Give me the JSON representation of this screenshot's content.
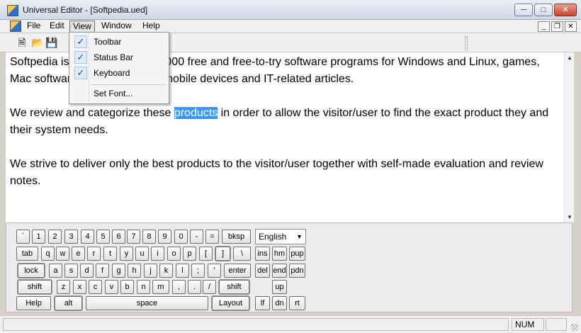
{
  "window": {
    "title": "Universal Editor - [Softpedia.ued]"
  },
  "menubar": {
    "items": [
      "File",
      "Edit",
      "View",
      "Window",
      "Help"
    ],
    "active": "View"
  },
  "view_menu": {
    "items": [
      {
        "label": "Toolbar",
        "checked": true
      },
      {
        "label": "Status Bar",
        "checked": true
      },
      {
        "label": "Keyboard",
        "checked": true
      },
      {
        "label": "Set Font...",
        "checked": false
      }
    ]
  },
  "toolbar": {
    "icons": [
      "new-document-icon",
      "open-folder-icon",
      "save-icon"
    ]
  },
  "editor": {
    "p1_line1_start": "Softpedia is ",
    "p1_line1_end": "0,000 free and free-to-try software programs for Windows and Linux, games,",
    "p1_line2_start": "Mac softwar",
    "p1_line2_end": " mobile devices and IT-related articles.",
    "p2_before": "We review and categorize these ",
    "p2_selected": "products",
    "p2_after": " in order to allow the visitor/user to find the exact product they and their system needs.",
    "p3": "We strive to deliver only the best products to the visitor/user together with self-made evaluation and review notes."
  },
  "keyboard": {
    "row1": [
      "`",
      "1",
      "2",
      "3",
      "4",
      "5",
      "6",
      "7",
      "8",
      "9",
      "0",
      "-",
      "=",
      "bksp"
    ],
    "row2": [
      "tab",
      "q",
      "w",
      "e",
      "r",
      "t",
      "y",
      "u",
      "i",
      "o",
      "p",
      "[",
      "]",
      "\\"
    ],
    "row3": [
      "lock",
      "a",
      "s",
      "d",
      "f",
      "g",
      "h",
      "j",
      "k",
      "l",
      ";",
      "'",
      "enter"
    ],
    "row4": [
      "shift",
      "z",
      "x",
      "c",
      "v",
      "b",
      "n",
      "m",
      ",",
      ".",
      "/",
      "shift"
    ],
    "row5": [
      "Help",
      "alt",
      "space",
      "Layout"
    ],
    "nav": [
      "ins",
      "hm",
      "pup",
      "del",
      "end",
      "pdn",
      "up",
      "lf",
      "dn",
      "rt"
    ],
    "language": "English"
  },
  "statusbar": {
    "num": "NUM"
  }
}
